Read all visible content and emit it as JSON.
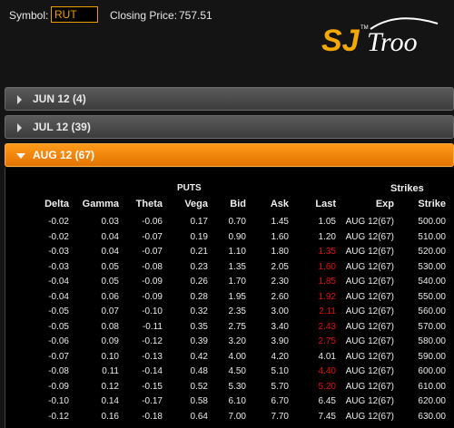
{
  "header": {
    "symbol_label": "Symbol:",
    "symbol_value": "RUT",
    "closing_label": "Closing Price:",
    "closing_value": "757.51",
    "logo_text": "SJ",
    "logo_tm": "TM",
    "logo_script": "Troo"
  },
  "expirations": [
    {
      "label": "JUN 12 (4)",
      "state": "collapsed"
    },
    {
      "label": "JUL 12 (39)",
      "state": "collapsed"
    },
    {
      "label": "AUG 12 (67)",
      "state": "expanded"
    }
  ],
  "table": {
    "puts_label": "PUTS",
    "strikes_label": "Strikes",
    "columns": [
      "Delta",
      "Gamma",
      "Theta",
      "Vega",
      "Bid",
      "Ask",
      "Last",
      "Exp",
      "Strike"
    ],
    "rows": [
      {
        "delta": "-0.02",
        "gamma": "0.03",
        "theta": "-0.06",
        "vega": "0.17",
        "bid": "0.70",
        "ask": "1.45",
        "last": "1.05",
        "last_color": "#eaeaea",
        "exp": "AUG 12(67)",
        "strike": "500.00"
      },
      {
        "delta": "-0.02",
        "gamma": "0.04",
        "theta": "-0.07",
        "vega": "0.19",
        "bid": "0.90",
        "ask": "1.60",
        "last": "1.20",
        "last_color": "#eaeaea",
        "exp": "AUG 12(67)",
        "strike": "510.00"
      },
      {
        "delta": "-0.03",
        "gamma": "0.04",
        "theta": "-0.07",
        "vega": "0.21",
        "bid": "1.10",
        "ask": "1.80",
        "last": "1.35",
        "last_color": "#e01010",
        "exp": "AUG 12(67)",
        "strike": "520.00"
      },
      {
        "delta": "-0.03",
        "gamma": "0.05",
        "theta": "-0.08",
        "vega": "0.23",
        "bid": "1.35",
        "ask": "2.05",
        "last": "1.60",
        "last_color": "#e01010",
        "exp": "AUG 12(67)",
        "strike": "530.00"
      },
      {
        "delta": "-0.04",
        "gamma": "0.05",
        "theta": "-0.09",
        "vega": "0.26",
        "bid": "1.70",
        "ask": "2.30",
        "last": "1.85",
        "last_color": "#e01010",
        "exp": "AUG 12(67)",
        "strike": "540.00"
      },
      {
        "delta": "-0.04",
        "gamma": "0.06",
        "theta": "-0.09",
        "vega": "0.28",
        "bid": "1.95",
        "ask": "2.60",
        "last": "1.92",
        "last_color": "#e01010",
        "exp": "AUG 12(67)",
        "strike": "550.00"
      },
      {
        "delta": "-0.05",
        "gamma": "0.07",
        "theta": "-0.10",
        "vega": "0.32",
        "bid": "2.35",
        "ask": "3.00",
        "last": "2.11",
        "last_color": "#e01010",
        "exp": "AUG 12(67)",
        "strike": "560.00"
      },
      {
        "delta": "-0.05",
        "gamma": "0.08",
        "theta": "-0.11",
        "vega": "0.35",
        "bid": "2.75",
        "ask": "3.40",
        "last": "2.43",
        "last_color": "#e01010",
        "exp": "AUG 12(67)",
        "strike": "570.00"
      },
      {
        "delta": "-0.06",
        "gamma": "0.09",
        "theta": "-0.12",
        "vega": "0.39",
        "bid": "3.20",
        "ask": "3.90",
        "last": "2.75",
        "last_color": "#e01010",
        "exp": "AUG 12(67)",
        "strike": "580.00"
      },
      {
        "delta": "-0.07",
        "gamma": "0.10",
        "theta": "-0.13",
        "vega": "0.42",
        "bid": "4.00",
        "ask": "4.20",
        "last": "4.01",
        "last_color": "#eaeaea",
        "exp": "AUG 12(67)",
        "strike": "590.00"
      },
      {
        "delta": "-0.08",
        "gamma": "0.11",
        "theta": "-0.14",
        "vega": "0.48",
        "bid": "4.50",
        "ask": "5.10",
        "last": "4.40",
        "last_color": "#e01010",
        "exp": "AUG 12(67)",
        "strike": "600.00"
      },
      {
        "delta": "-0.09",
        "gamma": "0.12",
        "theta": "-0.15",
        "vega": "0.52",
        "bid": "5.30",
        "ask": "5.70",
        "last": "5.20",
        "last_color": "#e01010",
        "exp": "AUG 12(67)",
        "strike": "610.00"
      },
      {
        "delta": "-0.10",
        "gamma": "0.14",
        "theta": "-0.17",
        "vega": "0.58",
        "bid": "6.10",
        "ask": "6.70",
        "last": "6.45",
        "last_color": "#eaeaea",
        "exp": "AUG 12(67)",
        "strike": "620.00"
      },
      {
        "delta": "-0.12",
        "gamma": "0.16",
        "theta": "-0.18",
        "vega": "0.64",
        "bid": "7.00",
        "ask": "7.70",
        "last": "7.45",
        "last_color": "#eaeaea",
        "exp": "AUG 12(67)",
        "strike": "630.00"
      }
    ]
  }
}
